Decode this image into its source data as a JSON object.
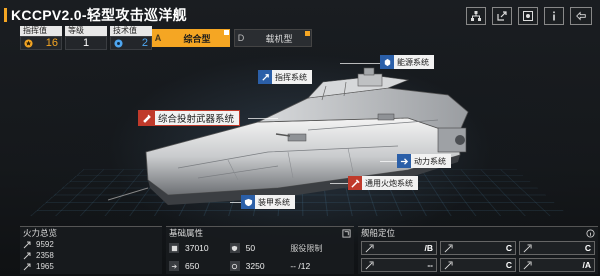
{
  "header": {
    "title": "KCCPV2.0-轻型攻击巡洋舰"
  },
  "top_icons": [
    {
      "name": "hierarchy-icon"
    },
    {
      "name": "share-icon"
    },
    {
      "name": "target-icon"
    },
    {
      "name": "info-icon"
    },
    {
      "name": "back-icon"
    }
  ],
  "stats": {
    "command": {
      "label": "指挥值",
      "value": "16"
    },
    "level": {
      "label": "等级",
      "value": "1"
    },
    "tech": {
      "label": "技术值",
      "value": "2"
    }
  },
  "tabs": [
    {
      "letter": "A",
      "label": "综合型",
      "active": true
    },
    {
      "letter": "D",
      "label": "载机型",
      "active": false
    }
  ],
  "callouts": {
    "energy": "能源系统",
    "command": "指挥系统",
    "weapons": "综合投射武器系统",
    "power": "动力系统",
    "artillery": "通用火炮系统",
    "armor": "装甲系统"
  },
  "panels": {
    "firepower": {
      "title": "火力总览",
      "rows": [
        "9592",
        "2358",
        "1965"
      ]
    },
    "base": {
      "title": "基础属性",
      "hp": "37010",
      "armor": "50",
      "limit_label": "服役限制",
      "speed": "650",
      "range": "3250",
      "limit_value": "-- /12"
    },
    "position": {
      "title": "舰船定位",
      "cells": [
        {
          "grade": "/B"
        },
        {
          "grade": "C"
        },
        {
          "grade": "C"
        },
        {
          "grade": "--"
        },
        {
          "grade": "C"
        },
        {
          "grade": "/A"
        }
      ]
    }
  },
  "colors": {
    "accent": "#f5a623",
    "blue": "#2b5fa8",
    "red": "#c03a2b"
  }
}
